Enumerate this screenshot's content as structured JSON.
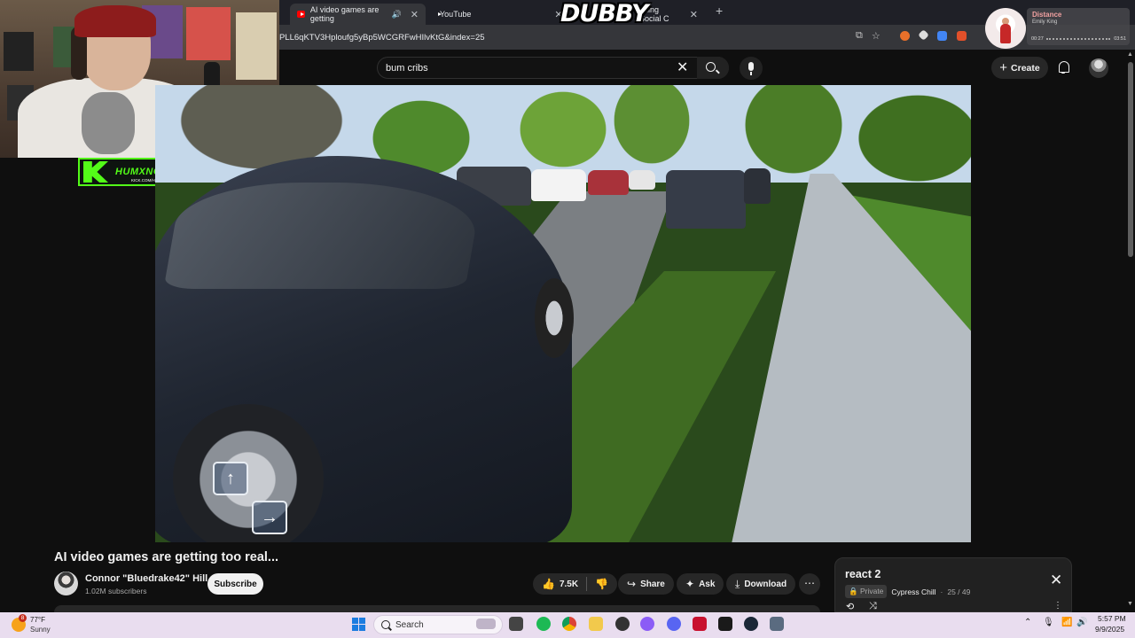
{
  "overlay": {
    "watermark": "DUBBY"
  },
  "browser": {
    "tabs": [
      {
        "label": "AI video games are getting",
        "active": true
      },
      {
        "label": "YouTube",
        "active": false
      },
      {
        "label": "ading Social C",
        "active": false
      }
    ],
    "url": "PLL6qKTV3Hploufg5yBp5WCGRFwHIlvKtG&index=25",
    "icons": [
      "install-icon",
      "star-icon",
      "extension-icons"
    ]
  },
  "now_playing": {
    "title": "Distance",
    "artist": "Emily King",
    "elapsed": "00:27",
    "duration": "03:51"
  },
  "stream_badge": {
    "name": "HUMXNGHXST",
    "url": "KICK.COM/HUMXNGHXST"
  },
  "youtube": {
    "search_value": "bum cribs",
    "create_label": "Create",
    "video": {
      "title": "AI video games are getting too real...",
      "channel": "Connor \"Bluedrake42\" Hill",
      "subscribers": "1.02M subscribers",
      "subscribe_label": "Subscribe",
      "likes": "7.5K",
      "share_label": "Share",
      "ask_label": "Ask",
      "download_label": "Download",
      "overlay_keys": [
        "up-arrow",
        "right-arrow"
      ]
    },
    "playlist": {
      "title": "react 2",
      "privacy": "Private",
      "owner": "Cypress Chill",
      "position": "25 / 49"
    }
  },
  "taskbar": {
    "weather_badge": "8",
    "temperature": "77°F",
    "condition": "Sunny",
    "search_label": "Search",
    "time": "5:57 PM",
    "date": "9/9/2025"
  },
  "colors": {
    "youtube_bg": "#0f0f0f",
    "kick_green": "#53fc18",
    "taskbar_bg": "#e9ddef",
    "accent_red": "#ff0000"
  }
}
